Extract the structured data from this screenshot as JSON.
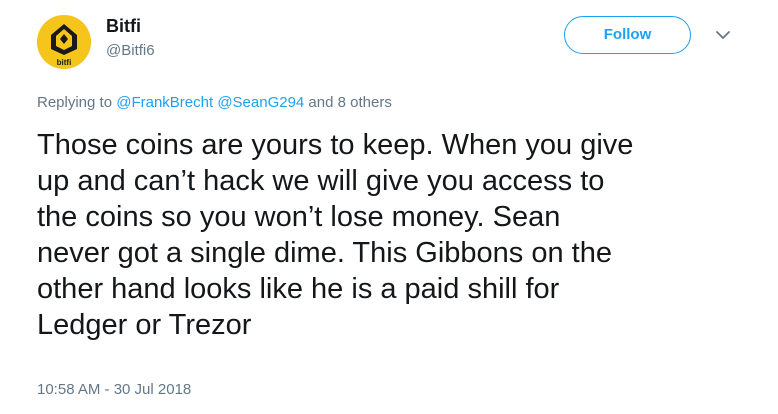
{
  "author": {
    "display_name": "Bitfi",
    "handle": "@Bitfi6",
    "avatar_icon": "bitfi-logo",
    "avatar_text": "bitfi",
    "avatar_color": "#f6c51c"
  },
  "actions": {
    "follow_label": "Follow",
    "menu_icon": "chevron-down-icon"
  },
  "reply_context": {
    "prefix": "Replying to ",
    "mentions": [
      "@FrankBrecht",
      "@SeanG294"
    ],
    "suffix": " and 8 others"
  },
  "tweet": {
    "text_lines": [
      "Those coins are yours to keep. When you give",
      "up and can’t hack we will give you access to",
      "the coins so you won’t lose money. Sean",
      "never got a single dime. This Gibbons on the",
      "other hand looks like he is a paid shill for",
      "Ledger or Trezor"
    ],
    "timestamp": "10:58 AM - 30 Jul 2018"
  },
  "colors": {
    "link": "#1da1f2",
    "secondary_text": "#657786",
    "primary_text": "#14171a"
  }
}
